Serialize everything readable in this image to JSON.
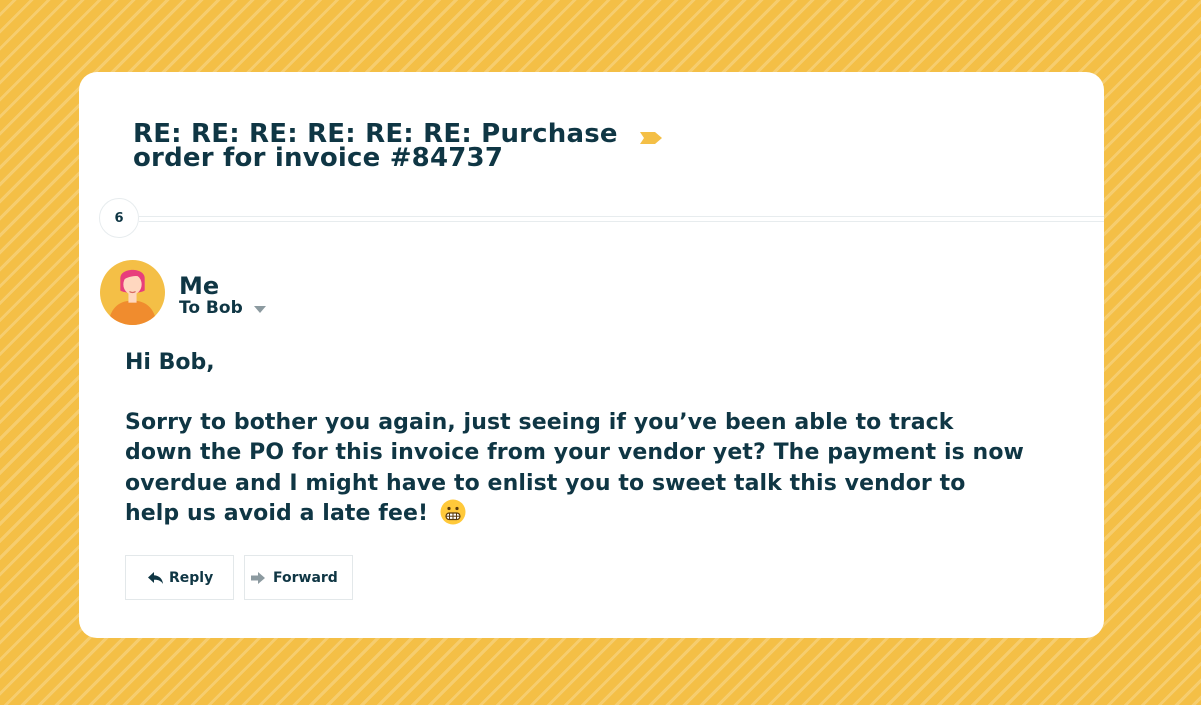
{
  "email": {
    "subject": "RE: RE: RE: RE: RE: RE: Purchase order for invoice #84737",
    "label_icon": "label-tag-icon",
    "label_color": "#f4bf46",
    "thread_count": "6",
    "sender": {
      "name": "Me",
      "recipient": "To Bob",
      "avatar_icon": "woman-avatar-icon"
    },
    "greeting": "Hi Bob,",
    "body": "Sorry to bother you again, just seeing if you’ve been able to track down the PO for this invoice from your vendor yet? The payment is now overdue and I might have to enlist you to sweet talk this vendor to help us avoid a late fee!",
    "body_emoji": "grimacing-face-emoji",
    "actions": {
      "reply_label": "Reply",
      "forward_label": "Forward"
    }
  },
  "colors": {
    "background": "#f4bf46",
    "card": "#ffffff",
    "text": "#0f3644"
  }
}
